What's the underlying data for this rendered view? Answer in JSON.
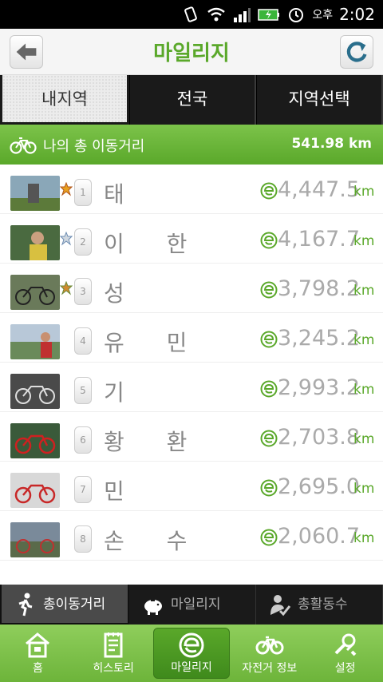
{
  "status_bar": {
    "ampm": "오후",
    "time": "2:02"
  },
  "header": {
    "title": "마일리지"
  },
  "region_tabs": [
    {
      "label": "내지역"
    },
    {
      "label": "전국"
    },
    {
      "label": "지역선택"
    }
  ],
  "total": {
    "label": "나의 총 이동거리",
    "value": "541.98 km"
  },
  "ranking": [
    {
      "rank": "1",
      "name": "태",
      "distance": "4,447.5",
      "unit": "km",
      "medal": "gold"
    },
    {
      "rank": "2",
      "name": "이 한",
      "distance": "4,167.7",
      "unit": "km",
      "medal": "silver"
    },
    {
      "rank": "3",
      "name": "성",
      "distance": "3,798.2",
      "unit": "km",
      "medal": "bronze"
    },
    {
      "rank": "4",
      "name": "유 민",
      "distance": "3,245.2",
      "unit": "km",
      "medal": ""
    },
    {
      "rank": "5",
      "name": "기",
      "distance": "2,993.2",
      "unit": "km",
      "medal": ""
    },
    {
      "rank": "6",
      "name": "황 환",
      "distance": "2,703.8",
      "unit": "km",
      "medal": ""
    },
    {
      "rank": "7",
      "name": "민",
      "distance": "2,695.0",
      "unit": "km",
      "medal": ""
    },
    {
      "rank": "8",
      "name": "손 수",
      "distance": "2,060.7",
      "unit": "km",
      "medal": ""
    }
  ],
  "sort_tabs": [
    {
      "label": "총이동거리"
    },
    {
      "label": "마일리지"
    },
    {
      "label": "총활동수"
    }
  ],
  "bottom_nav": [
    {
      "label": "홈",
      "icon": "home-icon"
    },
    {
      "label": "히스토리",
      "icon": "history-icon"
    },
    {
      "label": "마일리지",
      "icon": "mileage-icon"
    },
    {
      "label": "자전거 정보",
      "icon": "bicycle-icon"
    },
    {
      "label": "설정",
      "icon": "settings-icon"
    }
  ],
  "colors": {
    "accent": "#5aa82a",
    "dark": "#1a1a1a"
  }
}
